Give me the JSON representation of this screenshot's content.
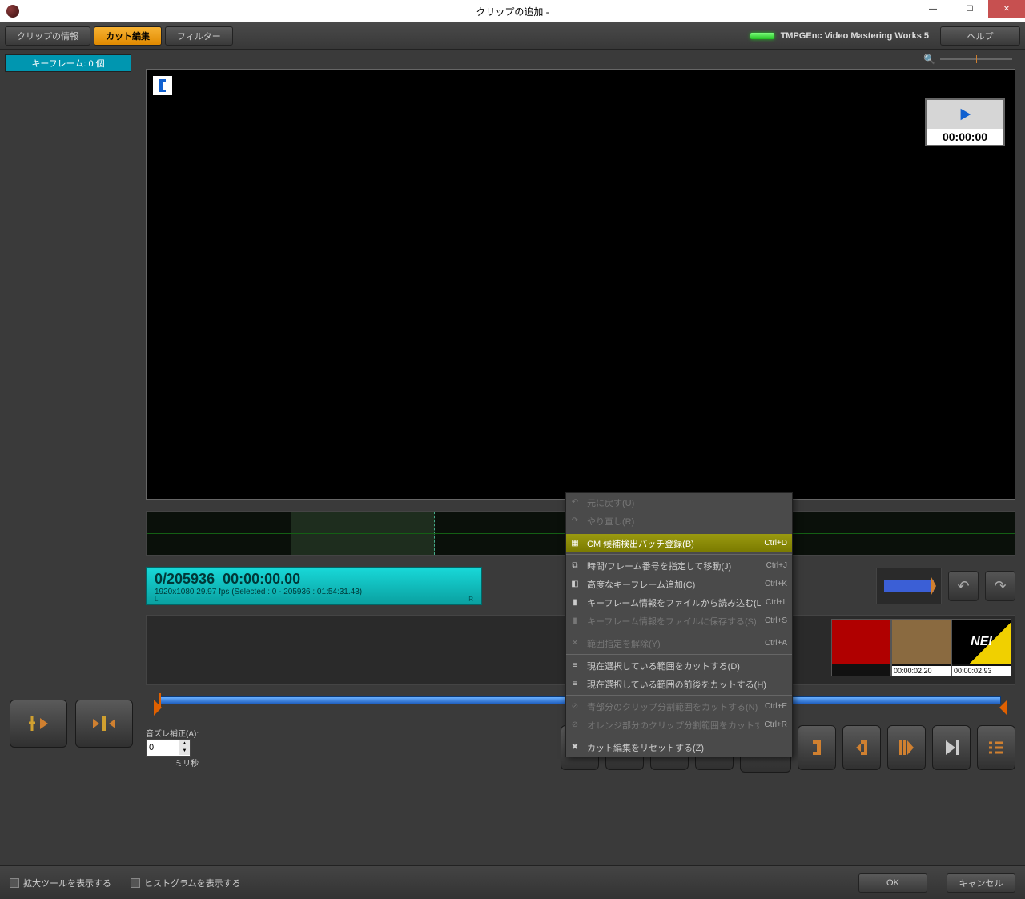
{
  "window": {
    "title": "クリップの追加 - "
  },
  "toolbar": {
    "tabs": [
      {
        "label": "クリップの情報",
        "active": false
      },
      {
        "label": "カット編集",
        "active": true
      },
      {
        "label": "フィルター",
        "active": false
      }
    ],
    "brand": "TMPGEnc Video Mastering Works 5",
    "help": "ヘルプ"
  },
  "sidebar": {
    "keyframe_header": "キーフレーム: 0 個"
  },
  "preview": {
    "pip_time": "00:00:00"
  },
  "counter": {
    "frames": "0/205936",
    "time": "00:00:00.00",
    "info": "1920x1080 29.97 fps  (Selected : 0 - 205936 : 01:54:31.43)",
    "l": "L",
    "r": "R"
  },
  "thumbs": [
    {
      "time": "00:00:02.20"
    },
    {
      "time": "00:00:02.93"
    }
  ],
  "sync": {
    "label": "音ズレ補正(A):",
    "value": "0",
    "unit": "ミリ秒"
  },
  "bottom": {
    "chk1": "拡大ツールを表示する",
    "chk2": "ヒストグラムを表示する",
    "ok": "OK",
    "cancel": "キャンセル"
  },
  "context_menu": [
    {
      "type": "item",
      "label": "元に戻す(U)",
      "shortcut": "",
      "icon": "↶",
      "disabled": true
    },
    {
      "type": "item",
      "label": "やり直し(R)",
      "shortcut": "",
      "icon": "↷",
      "disabled": true
    },
    {
      "type": "sep"
    },
    {
      "type": "item",
      "label": "CM 候補検出バッチ登録(B)",
      "shortcut": "Ctrl+D",
      "icon": "▦",
      "hilite": true
    },
    {
      "type": "sep"
    },
    {
      "type": "item",
      "label": "時間/フレーム番号を指定して移動(J)",
      "shortcut": "Ctrl+J",
      "icon": "⧉"
    },
    {
      "type": "item",
      "label": "高度なキーフレーム追加(C)",
      "shortcut": "Ctrl+K",
      "icon": "◧"
    },
    {
      "type": "item",
      "label": "キーフレーム情報をファイルから読み込む(L)",
      "shortcut": "Ctrl+L",
      "icon": "▮"
    },
    {
      "type": "item",
      "label": "キーフレーム情報をファイルに保存する(S)",
      "shortcut": "Ctrl+S",
      "icon": "▮",
      "disabled": true
    },
    {
      "type": "sep"
    },
    {
      "type": "item",
      "label": "範囲指定を解除(Y)",
      "shortcut": "Ctrl+A",
      "icon": "✕",
      "disabled": true
    },
    {
      "type": "sep"
    },
    {
      "type": "item",
      "label": "現在選択している範囲をカットする(D)",
      "shortcut": "",
      "icon": "≡"
    },
    {
      "type": "item",
      "label": "現在選択している範囲の前後をカットする(H)",
      "shortcut": "",
      "icon": "≡"
    },
    {
      "type": "sep"
    },
    {
      "type": "item",
      "label": "青部分のクリップ分割範囲をカットする(N)",
      "shortcut": "Ctrl+E",
      "icon": "⊘",
      "disabled": true
    },
    {
      "type": "item",
      "label": "オレンジ部分のクリップ分割範囲をカットする(M)",
      "shortcut": "Ctrl+R",
      "icon": "⊘",
      "disabled": true
    },
    {
      "type": "sep"
    },
    {
      "type": "item",
      "label": "カット編集をリセットする(Z)",
      "shortcut": "",
      "icon": "✖"
    }
  ]
}
